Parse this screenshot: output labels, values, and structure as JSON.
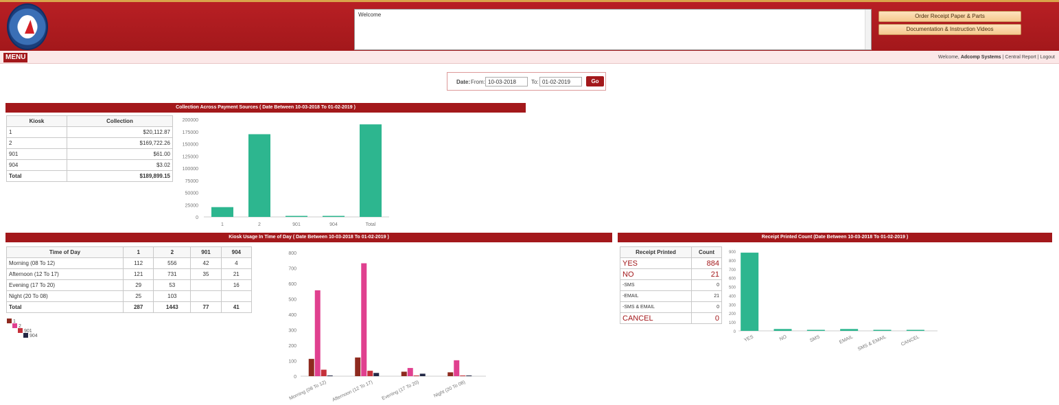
{
  "header": {
    "welcome_text": "Welcome",
    "order_button": "Order Receipt Paper & Parts",
    "docs_button": "Documentation & Instruction Videos"
  },
  "menubar": {
    "menu_label": "MENU",
    "welcome_prefix": "Welcome,",
    "user_name": "Adcomp Systems",
    "separator": "|",
    "central_report": "Central Report",
    "logout": "Logout"
  },
  "date_filter": {
    "date_label": "Date:",
    "from_label": "From:",
    "from_value": "10-03-2018",
    "to_label": "To:",
    "to_value": "01-02-2019",
    "go_label": "Go"
  },
  "collection_panel": {
    "title": "Collection Across Payment Sources ( Date Between 10-03-2018 To 01-02-2019 )",
    "columns": [
      "Kiosk",
      "Collection"
    ],
    "rows": [
      [
        "1",
        "$20,112.87"
      ],
      [
        "2",
        "$169,722.26"
      ],
      [
        "901",
        "$61.00"
      ],
      [
        "904",
        "$3.02"
      ],
      [
        "Total",
        "$189,899.15"
      ]
    ]
  },
  "usage_panel": {
    "title": "Kiosk Usage In Time of Day ( Date Between 10-03-2018 To 01-02-2019 )",
    "columns": [
      "Time of Day",
      "1",
      "2",
      "901",
      "904"
    ],
    "rows": [
      [
        "Morning (08 To 12)",
        "112",
        "556",
        "42",
        "4"
      ],
      [
        "Afternoon (12 To 17)",
        "121",
        "731",
        "35",
        "21"
      ],
      [
        "Evening (17 To 20)",
        "29",
        "53",
        "",
        "16"
      ],
      [
        "Night (20 To 08)",
        "25",
        "103",
        "",
        ""
      ],
      [
        "Total",
        "287",
        "1443",
        "77",
        "41"
      ]
    ],
    "legend": [
      "1",
      "2",
      "901",
      "904"
    ]
  },
  "receipt_panel": {
    "title": "Receipt Printed Count (Date Between 10-03-2018 To 01-02-2019 )",
    "columns": [
      "Receipt Printed",
      "Count"
    ],
    "rows": [
      [
        "YES",
        "884"
      ],
      [
        "NO",
        "21"
      ],
      [
        "-SMS",
        "0"
      ],
      [
        "-EMAIL",
        "21"
      ],
      [
        "-SMS & EMAIL",
        "0"
      ],
      [
        "CANCEL",
        "0"
      ]
    ]
  },
  "colors": {
    "brand_red": "#a3181b",
    "bar_teal": "#2db68f",
    "series_1": "#8e2a1f",
    "series_2": "#e0408f",
    "series_901": "#c5303a",
    "series_904": "#232845"
  },
  "chart_data": [
    {
      "type": "bar",
      "categories": [
        "1",
        "2",
        "901",
        "904",
        "Total"
      ],
      "values": [
        20112.87,
        169722.26,
        61.0,
        3.02,
        189899.15
      ],
      "title": "",
      "xlabel": "",
      "ylabel": "",
      "ylim": [
        0,
        200000
      ],
      "yticks": [
        0,
        25000,
        50000,
        75000,
        100000,
        125000,
        150000,
        175000,
        200000
      ]
    },
    {
      "type": "bar",
      "categories": [
        "Morning (08 To 12)",
        "Afternoon (12 To 17)",
        "Evening (17 To 20)",
        "Night (20 To 08)"
      ],
      "series": [
        {
          "name": "1",
          "values": [
            112,
            121,
            29,
            25
          ]
        },
        {
          "name": "2",
          "values": [
            556,
            731,
            53,
            103
          ]
        },
        {
          "name": "901",
          "values": [
            42,
            35,
            0,
            0
          ]
        },
        {
          "name": "904",
          "values": [
            4,
            21,
            16,
            0
          ]
        }
      ],
      "title": "",
      "xlabel": "",
      "ylabel": "",
      "ylim": [
        0,
        800
      ],
      "yticks": [
        0,
        100,
        200,
        300,
        400,
        500,
        600,
        700,
        800
      ]
    },
    {
      "type": "bar",
      "categories": [
        "YES",
        "NO",
        "SMS",
        "EMAIL",
        "SMS & EMAIL",
        "CANCEL"
      ],
      "values": [
        884,
        21,
        0,
        21,
        0,
        0
      ],
      "title": "",
      "xlabel": "",
      "ylabel": "",
      "ylim": [
        0,
        900
      ],
      "yticks": [
        0,
        100,
        200,
        300,
        400,
        500,
        600,
        700,
        800,
        900
      ]
    }
  ]
}
